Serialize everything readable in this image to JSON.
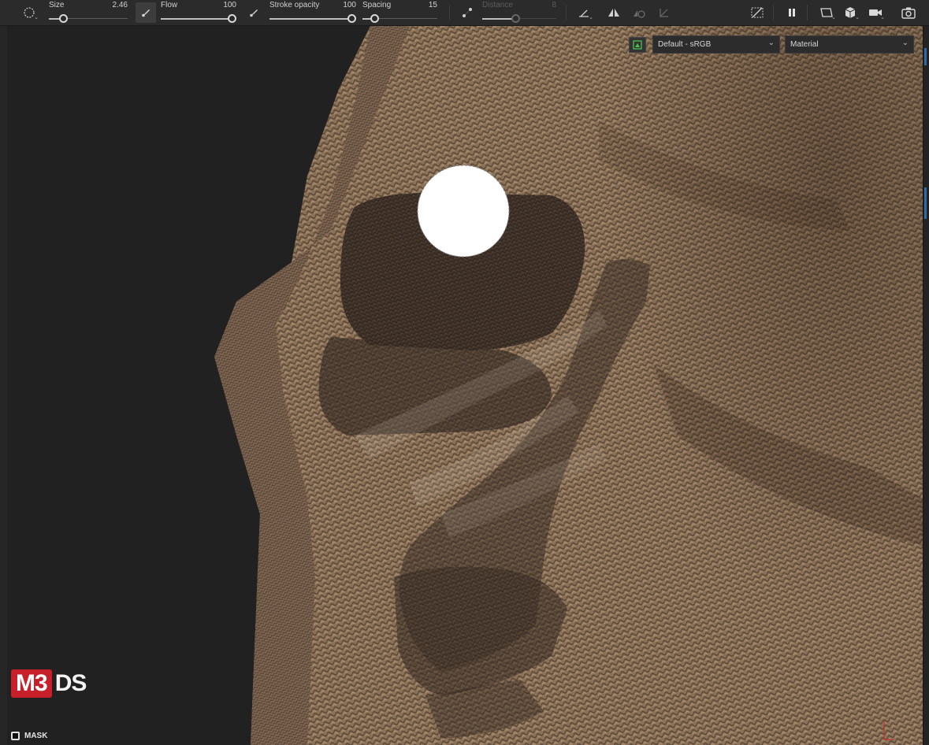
{
  "toolbar": {
    "size": {
      "label": "Size",
      "value": "2.46",
      "fraction": 0.15
    },
    "flow": {
      "label": "Flow",
      "value": "100",
      "fraction": 1.0
    },
    "stroke_opacity": {
      "label": "Stroke opacity",
      "value": "100",
      "fraction": 1.0
    },
    "spacing": {
      "label": "Spacing",
      "value": "15",
      "fraction": 0.12
    },
    "distance": {
      "label": "Distance",
      "value": "8",
      "fraction": 0.45,
      "disabled": true
    },
    "icons": [
      "brush-shape-icon",
      "brush-tip-icon",
      "alpha-icon",
      "lazy-mouse-icon",
      "symmetry-icon",
      "mirror-icon",
      "mirror-rotate-icon",
      "tangent-icon",
      "hide-mesh-icon",
      "pause-icon",
      "viewport-mode-icon",
      "cube-icon",
      "camera-icon",
      "screenshot-icon"
    ]
  },
  "viewport": {
    "color_profile": "Default - sRGB",
    "display_channel": "Material"
  },
  "overlay": {
    "logo_box": "M3",
    "logo_text": "DS",
    "mask_label": "MASK"
  },
  "colors": {
    "toolbar_bg": "#2b2b2b",
    "viewport_bg": "#212121",
    "cloth": "#8d7459",
    "cloth_dark": "#3a2e24",
    "brush_cursor": "#ffffff",
    "logo_red": "#c8202a"
  }
}
